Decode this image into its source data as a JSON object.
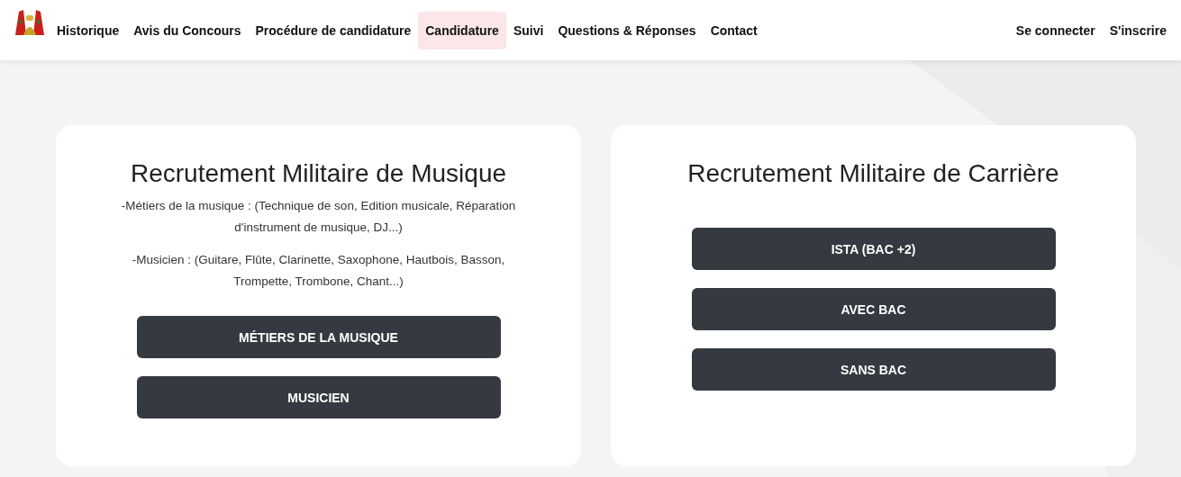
{
  "nav": {
    "items": [
      {
        "label": "Historique",
        "selected": false
      },
      {
        "label": "Avis du Concours",
        "selected": false
      },
      {
        "label": "Procédure de candidature",
        "selected": false
      },
      {
        "label": "Candidature",
        "selected": true
      },
      {
        "label": "Suivi",
        "selected": false
      },
      {
        "label": "Questions & Réponses",
        "selected": false
      },
      {
        "label": "Contact",
        "selected": false
      }
    ],
    "account": [
      "Se connecter",
      "S'inscrire"
    ]
  },
  "cards": [
    {
      "title": "Recrutement Militaire de Musique",
      "paragraphs": [
        "-Métiers de la musique : (Technique de son, Edition musicale, Réparation d'instrument de musique, DJ...)",
        "-Musicien : (Guitare, Flûte, Clarinette, Saxophone, Hautbois, Basson, Trompette, Trombone, Chant...)"
      ],
      "buttons": [
        "MÉTIERS DE LA MUSIQUE",
        "MUSICIEN"
      ]
    },
    {
      "title": "Recrutement Militaire de Carrière",
      "buttons": [
        "ISTA (BAC +2)",
        "AVEC BAC",
        "SANS BAC"
      ]
    }
  ]
}
